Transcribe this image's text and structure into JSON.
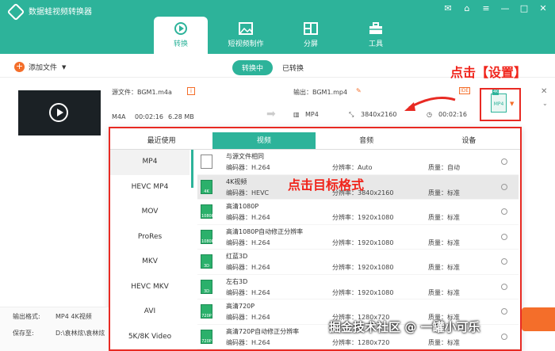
{
  "app": {
    "title": "数据蛙视频转换器"
  },
  "tabs": [
    {
      "label": "转换",
      "active": true
    },
    {
      "label": "短视频制作",
      "active": false
    },
    {
      "label": "分屏",
      "active": false
    },
    {
      "label": "工具",
      "active": false
    }
  ],
  "toolbar": {
    "add_file": "添加文件",
    "converting": "转换中",
    "converted": "已转换"
  },
  "file": {
    "source_label": "源文件：BGM1.m4a",
    "format": "M4A",
    "duration": "00:02:16",
    "size": "6.28 MB",
    "output_label": "输出：BGM1.mp4",
    "out_format": "MP4",
    "resolution": "3840x2160",
    "out_duration": "00:02:16",
    "fmt_badge": "4K",
    "fmt_icon_text": "MP4"
  },
  "annotations": {
    "click_settings": "点击【设置】",
    "click_target": "点击目标格式"
  },
  "panel": {
    "tabs": [
      "最近使用",
      "视频",
      "音频",
      "设备"
    ],
    "left_items": [
      "MP4",
      "HEVC MP4",
      "MOV",
      "ProRes",
      "MKV",
      "HEVC MKV",
      "AVI",
      "5K/8K Video"
    ],
    "rows": [
      {
        "name": "与源文件相同",
        "codec": "编码器：H.264",
        "res": "分辨率：Auto",
        "quality": "质量：自动",
        "icon": ""
      },
      {
        "name": "4K视频",
        "codec": "编码器：HEVC",
        "res": "分辨率：3840x2160",
        "quality": "质量：标准",
        "icon": "4K"
      },
      {
        "name": "高清1080P",
        "codec": "编码器：H.264",
        "res": "分辨率：1920x1080",
        "quality": "质量：标准",
        "icon": "1080P"
      },
      {
        "name": "高清1080P自动修正分辨率",
        "codec": "编码器：H.264",
        "res": "分辨率：1920x1080",
        "quality": "质量：标准",
        "icon": "1080P"
      },
      {
        "name": "红蓝3D",
        "codec": "编码器：H.264",
        "res": "分辨率：1920x1080",
        "quality": "质量：标准",
        "icon": "3D"
      },
      {
        "name": "左右3D",
        "codec": "编码器：H.264",
        "res": "分辨率：1920x1080",
        "quality": "质量：标准",
        "icon": "3D"
      },
      {
        "name": "高清720P",
        "codec": "编码器：H.264",
        "res": "分辨率：1280x720",
        "quality": "质量：标准",
        "icon": "720P"
      },
      {
        "name": "高清720P自动修正分辨率",
        "codec": "编码器：H.264",
        "res": "分辨率：1280x720",
        "quality": "质量：标准",
        "icon": "720P"
      }
    ]
  },
  "bottom": {
    "output_format_label": "输出格式:",
    "output_format_value": "MP4 4K视频",
    "save_label": "保存至:",
    "save_value": "D:\\袁林炫\\袁林炫"
  },
  "watermark": "掘金技术社区 @ 一罐小可乐",
  "colors": {
    "brand": "#2db39a",
    "accent": "#f46e2a",
    "annotation": "#f0241b"
  }
}
